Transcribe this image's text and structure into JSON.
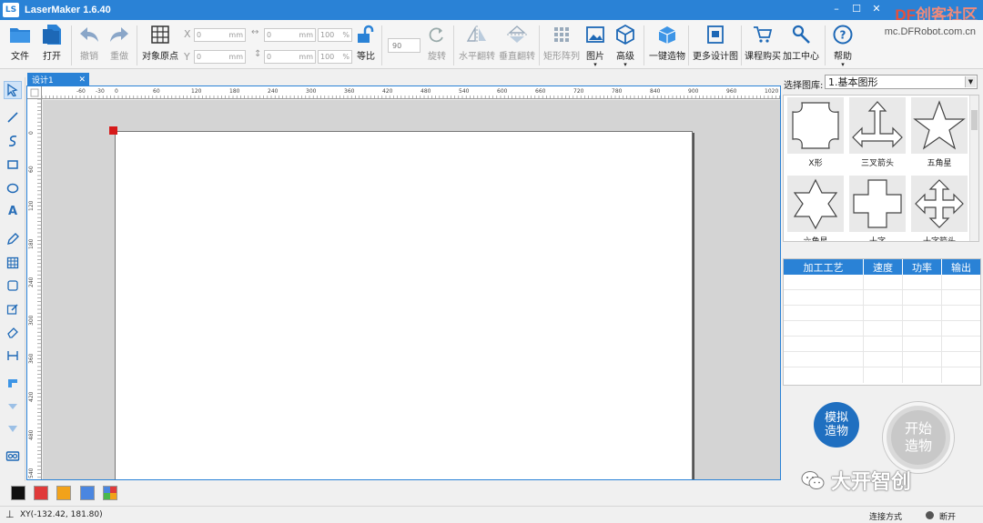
{
  "window": {
    "title": "LaserMaker 1.6.40",
    "logo_text": "LS",
    "controls": [
      "–",
      "☐",
      "✕"
    ]
  },
  "watermark": {
    "brand": "DF",
    "brand_cn": "创客社区",
    "url": "mc.DFRobot.com.cn"
  },
  "toolbar": {
    "file": "文件",
    "open": "打开",
    "undo": "撤销",
    "redo": "重做",
    "object_origin": "对象原点",
    "x_label": "X",
    "y_label": "Y",
    "x_value": "0",
    "y_value": "0",
    "w_value": "0",
    "h_value": "0",
    "unit_mm": "mm",
    "w_pct": "100",
    "h_pct": "100",
    "pct": "%",
    "proportional": "等比",
    "rotate_value": "90",
    "rotate": "旋转",
    "flip_h": "水平翻转",
    "flip_v": "垂直翻转",
    "rect_array": "矩形阵列",
    "image": "图片",
    "advanced": "高级",
    "one_click": "一键造物",
    "more_designs": "更多设计图",
    "course_buy": "课程购买",
    "process_center": "加工中心",
    "help": "帮助"
  },
  "document": {
    "tab_label": "设计1",
    "tab_close": "✕"
  },
  "ruler": {
    "h_ticks": [
      "-60",
      "-30",
      "0",
      "60",
      "120",
      "180",
      "240",
      "300",
      "360",
      "420",
      "480",
      "540",
      "600",
      "660",
      "720",
      "780",
      "840",
      "900",
      "960",
      "1020"
    ],
    "v_ticks": [
      "0",
      "60",
      "120",
      "180",
      "240",
      "300",
      "360",
      "420",
      "480",
      "540"
    ]
  },
  "library": {
    "label": "选择图库:",
    "selected": "1.基本图形",
    "shapes": [
      "X形",
      "三叉箭头",
      "五角星",
      "六角星",
      "十字",
      "十字箭头"
    ]
  },
  "process_table": {
    "headers": [
      "加工工艺",
      "速度",
      "功率",
      "输出"
    ]
  },
  "actions": {
    "simulate": "模拟造物",
    "start": "开始造物"
  },
  "brand_footer": "大开智创",
  "colors": {
    "swatches": [
      "#111111",
      "#e03a3a",
      "#f2a21a",
      "#4a86e0",
      "multi"
    ]
  },
  "status": {
    "xy": "XY(-132.42, 181.80)",
    "connection_label": "连接方式",
    "connection_state": "断开"
  }
}
